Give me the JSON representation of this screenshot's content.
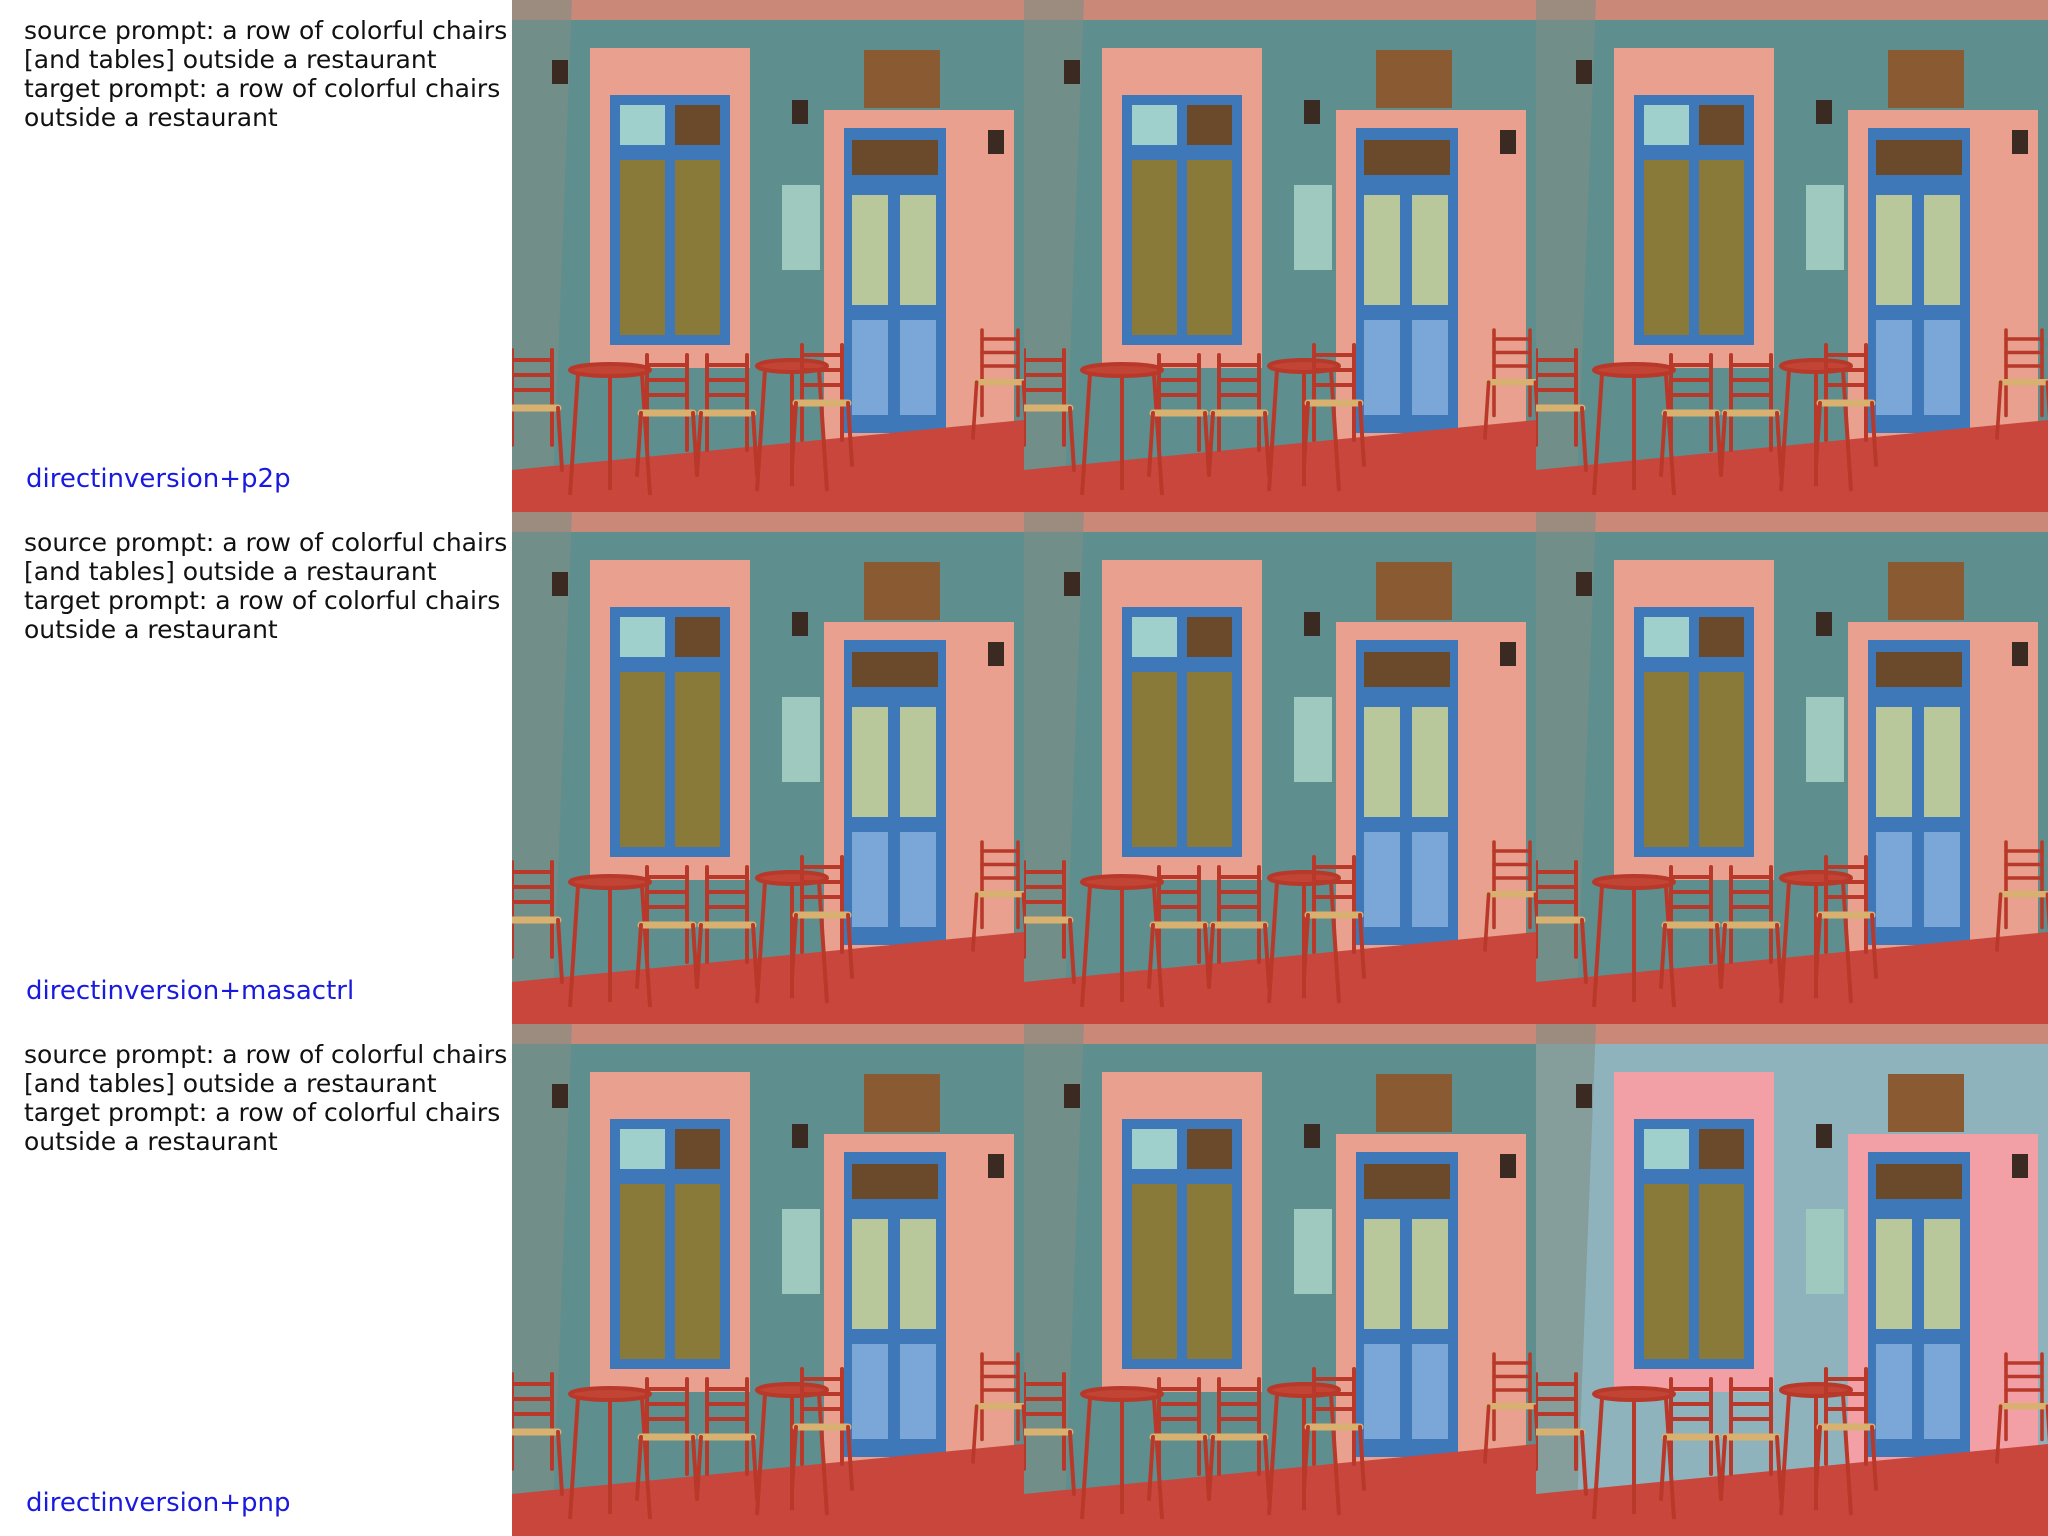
{
  "rows": [
    {
      "source_prompt": "source prompt: a row of colorful chairs [and tables] outside a restaurant",
      "target_prompt": "target prompt: a row of colorful chairs outside a restaurant",
      "method": "directinversion+p2p"
    },
    {
      "source_prompt": "source prompt: a row of colorful chairs [and tables] outside a restaurant",
      "target_prompt": "target prompt: a row of colorful chairs outside a restaurant",
      "method": "directinversion+masactrl"
    },
    {
      "source_prompt": "source prompt: a row of colorful chairs [and tables] outside a restaurant",
      "target_prompt": "target prompt: a row of colorful chairs outside a restaurant",
      "method": "directinversion+pnp"
    }
  ],
  "colors": {
    "method_label": "#1a1adf",
    "wall_teal": "#5f8e8e",
    "wall_pink": "#e9a08f",
    "door_blue": "#3e78b8",
    "floor_red": "#c9463c",
    "chair_red": "#b8392a"
  }
}
